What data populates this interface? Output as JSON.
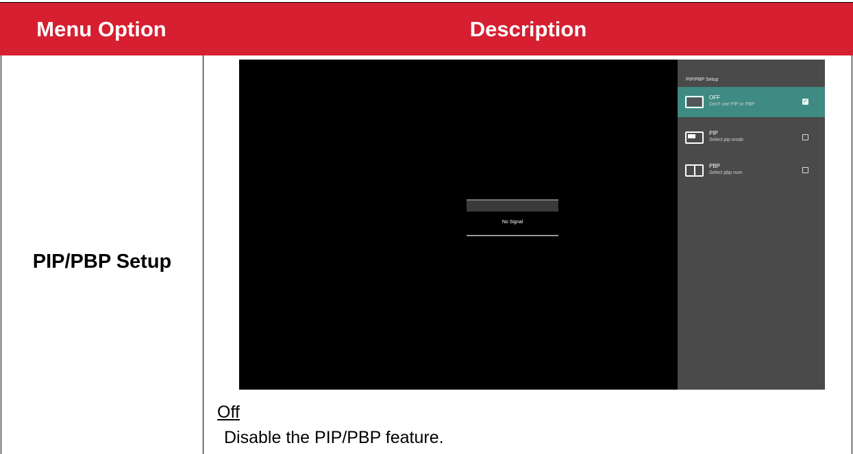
{
  "table": {
    "header": {
      "option": "Menu Option",
      "description": "Description"
    },
    "row": {
      "option": "PIP/PBP Setup",
      "screen": {
        "no_signal": "No Signal",
        "panel": {
          "title": "PIP/PBP Setup",
          "items": [
            {
              "name": "OFF",
              "subtitle": "Don't use PIP or PBP",
              "icon": "screen-off-icon",
              "checked": true
            },
            {
              "name": "PIP",
              "subtitle": "Select pip mode",
              "icon": "pip-icon",
              "checked": false
            },
            {
              "name": "PBP",
              "subtitle": "Select pbp num",
              "icon": "pbp-icon",
              "checked": false
            }
          ],
          "accent_color": "#3f8a82"
        }
      },
      "off_heading": "Off",
      "off_description": "Disable the PIP/PBP feature."
    }
  },
  "colors": {
    "header_bg": "#d61f31",
    "header_text": "#ffffff"
  }
}
